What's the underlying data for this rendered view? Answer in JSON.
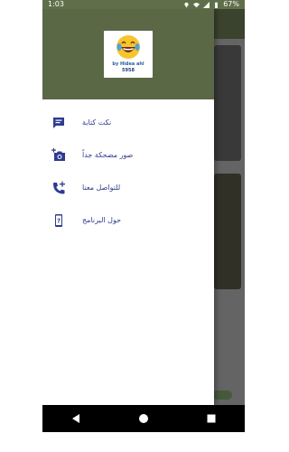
{
  "status_bar": {
    "time": "1:03",
    "battery": "67%"
  },
  "drawer": {
    "logo": {
      "line1": "by Hidea ahl",
      "line2": "5958"
    },
    "menu_items": [
      {
        "label": "نكت كتابة",
        "icon": "message-icon"
      },
      {
        "label": "صور مضحكة جداً",
        "icon": "add-photo-icon"
      },
      {
        "label": "للتواصل معنا",
        "icon": "add-call-icon"
      },
      {
        "label": "حول البرنامج",
        "icon": "help-phone-icon"
      }
    ]
  },
  "colors": {
    "header": "#5a6846",
    "accent_icon": "#2f3b8f",
    "label": "#2f3b8f"
  },
  "navigation_bar": {
    "back": "back-icon",
    "home": "home-icon",
    "recents": "recents-icon"
  }
}
